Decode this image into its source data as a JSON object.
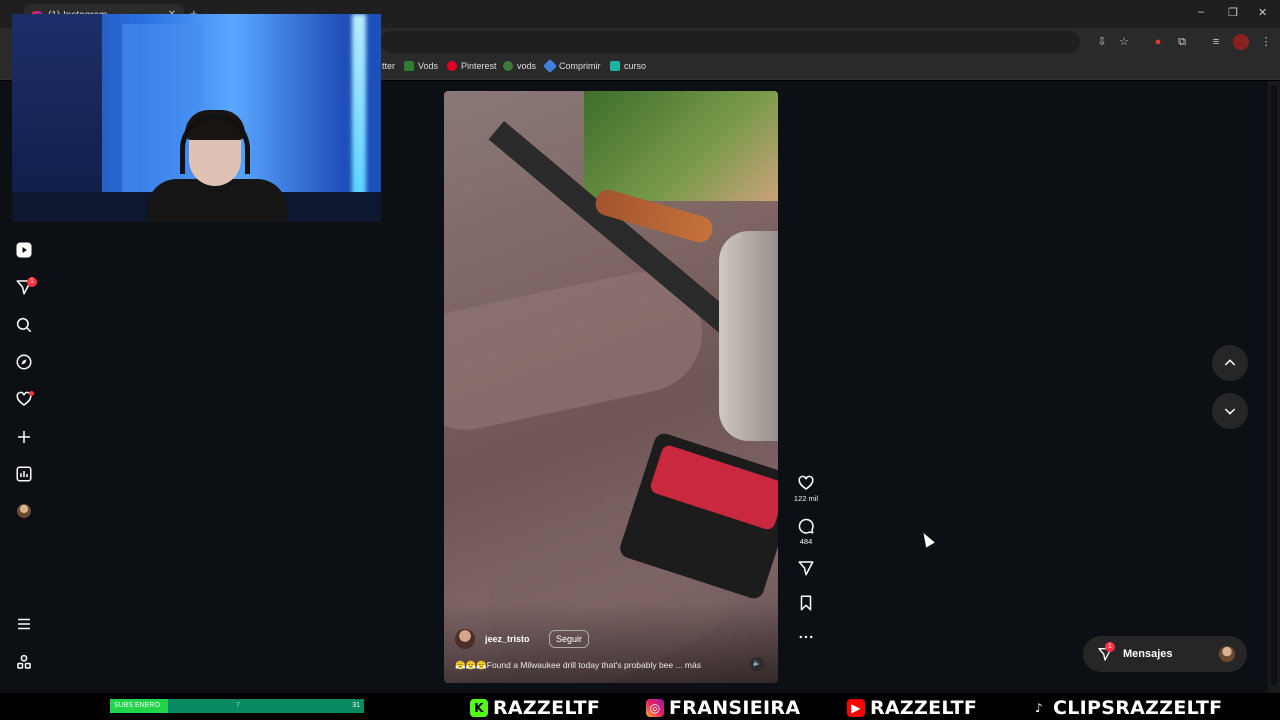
{
  "browser": {
    "tab_title": "(1) Instagram",
    "new_tab": "+",
    "window_controls": [
      "–",
      "❐",
      "✕"
    ]
  },
  "bookmarks": [
    {
      "label": "tter",
      "color": "#444444"
    },
    {
      "label": "Vods",
      "color": "#2e7d32"
    },
    {
      "label": "Pinterest",
      "color": "#e60023"
    },
    {
      "label": "vods",
      "color": "#3c7a3c"
    },
    {
      "label": "Comprimir",
      "color": "#3f7fd8"
    },
    {
      "label": "curso",
      "color": "#1bb3a3"
    }
  ],
  "sidebar": {
    "notifications_badge": "1",
    "icons": [
      "reels-icon",
      "direct-icon",
      "search-icon",
      "explore-icon",
      "heart-icon",
      "create-icon",
      "dashboard-icon",
      "profile-avatar"
    ],
    "bottom_icons": [
      "menu-icon",
      "threads-icon"
    ]
  },
  "reel": {
    "username": "jeez_tristo",
    "follow_label": "Seguir",
    "caption": "😤😤😤Found a Milwaukee drill today that's probably bee ... más",
    "likes": "122 mil",
    "comments": "484"
  },
  "messages": {
    "label": "Mensajes",
    "badge": "1"
  },
  "stream": {
    "subs_label": "SUBS ENERO",
    "subs_current": "7",
    "subs_goal": "31",
    "subs_progress": 0.23,
    "socials": [
      {
        "icon": "kick-icon",
        "name": "RAZZELTF",
        "color": "#53fc18"
      },
      {
        "icon": "instagram-icon",
        "name": "FRANSIEIRA",
        "color": "#e1306c"
      },
      {
        "icon": "youtube-icon",
        "name": "RAZZELTF",
        "color": "#ff0000"
      },
      {
        "icon": "tiktok-icon",
        "name": "CLIPSRAZZELTF",
        "color": "#ffffff"
      }
    ]
  }
}
